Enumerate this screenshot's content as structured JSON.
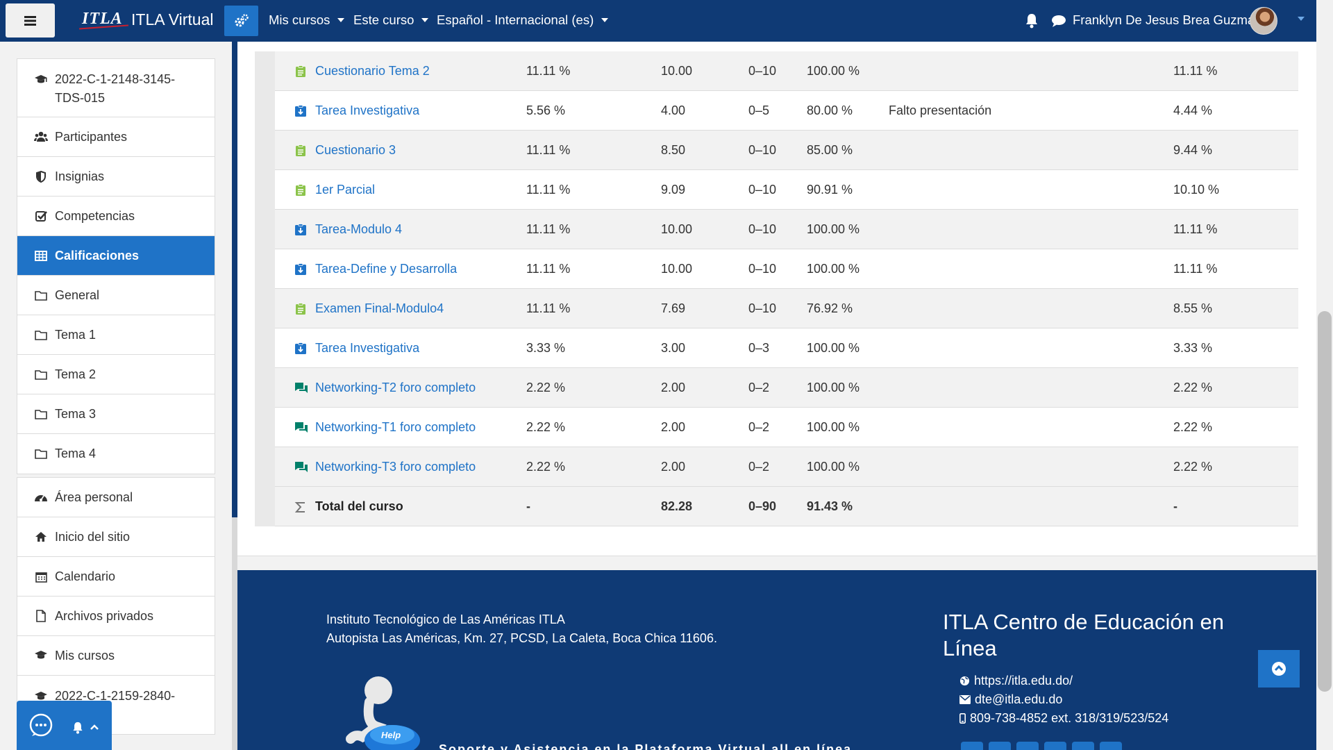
{
  "navbar": {
    "logo": "ITLA",
    "site_name": "ITLA Virtual",
    "menus": [
      "Mis cursos",
      "Este curso",
      "Español - Internacional (es)"
    ],
    "username": "Franklyn De Jesus Brea Guzman",
    "bg_color": "#0f3a75",
    "accent_color": "#1f73c7"
  },
  "drawer": {
    "course_group": [
      {
        "label": "2022-C-1-2148-3145-TDS-015",
        "icon": "graduation-cap-icon"
      },
      {
        "label": "Participantes",
        "icon": "users-icon"
      },
      {
        "label": "Insignias",
        "icon": "shield-icon"
      },
      {
        "label": "Competencias",
        "icon": "checkbox-icon"
      },
      {
        "label": "Calificaciones",
        "icon": "table-icon",
        "active": true
      },
      {
        "label": "General",
        "icon": "folder-icon"
      },
      {
        "label": "Tema 1",
        "icon": "folder-icon"
      },
      {
        "label": "Tema 2",
        "icon": "folder-icon"
      },
      {
        "label": "Tema 3",
        "icon": "folder-icon"
      },
      {
        "label": "Tema 4",
        "icon": "folder-icon"
      }
    ],
    "site_group": [
      {
        "label": "Área personal",
        "icon": "dashboard-icon"
      },
      {
        "label": "Inicio del sitio",
        "icon": "home-icon"
      },
      {
        "label": "Calendario",
        "icon": "calendar-icon"
      },
      {
        "label": "Archivos privados",
        "icon": "file-icon"
      },
      {
        "label": "Mis cursos",
        "icon": "graduation-cap-icon"
      },
      {
        "label": "2022-C-1-2159-2840-",
        "icon": "graduation-cap-icon"
      }
    ]
  },
  "grades": {
    "rows": [
      {
        "name": "Cuestionario Tema 2",
        "type": "quiz",
        "weight": "11.11 %",
        "grade": "10.00",
        "range": "0–10",
        "percentage": "100.00 %",
        "feedback": "",
        "contribution": "11.11 %"
      },
      {
        "name": "Tarea Investigativa",
        "type": "assign",
        "weight": "5.56 %",
        "grade": "4.00",
        "range": "0–5",
        "percentage": "80.00 %",
        "feedback": "Falto presentación",
        "contribution": "4.44 %"
      },
      {
        "name": "Cuestionario 3",
        "type": "quiz",
        "weight": "11.11 %",
        "grade": "8.50",
        "range": "0–10",
        "percentage": "85.00 %",
        "feedback": "",
        "contribution": "9.44 %"
      },
      {
        "name": "1er Parcial",
        "type": "quiz",
        "weight": "11.11 %",
        "grade": "9.09",
        "range": "0–10",
        "percentage": "90.91 %",
        "feedback": "",
        "contribution": "10.10 %"
      },
      {
        "name": "Tarea-Modulo 4",
        "type": "assign",
        "weight": "11.11 %",
        "grade": "10.00",
        "range": "0–10",
        "percentage": "100.00 %",
        "feedback": "",
        "contribution": "11.11 %"
      },
      {
        "name": "Tarea-Define y Desarrolla",
        "type": "assign",
        "weight": "11.11 %",
        "grade": "10.00",
        "range": "0–10",
        "percentage": "100.00 %",
        "feedback": "",
        "contribution": "11.11 %"
      },
      {
        "name": "Examen Final-Modulo4",
        "type": "quiz",
        "weight": "11.11 %",
        "grade": "7.69",
        "range": "0–10",
        "percentage": "76.92 %",
        "feedback": "",
        "contribution": "8.55 %"
      },
      {
        "name": "Tarea Investigativa",
        "type": "assign",
        "weight": "3.33 %",
        "grade": "3.00",
        "range": "0–3",
        "percentage": "100.00 %",
        "feedback": "",
        "contribution": "3.33 %"
      },
      {
        "name": "Networking-T2 foro completo",
        "type": "forum",
        "weight": "2.22 %",
        "grade": "2.00",
        "range": "0–2",
        "percentage": "100.00 %",
        "feedback": "",
        "contribution": "2.22 %"
      },
      {
        "name": "Networking-T1 foro completo",
        "type": "forum",
        "weight": "2.22 %",
        "grade": "2.00",
        "range": "0–2",
        "percentage": "100.00 %",
        "feedback": "",
        "contribution": "2.22 %"
      },
      {
        "name": "Networking-T3 foro completo",
        "type": "forum",
        "weight": "2.22 %",
        "grade": "2.00",
        "range": "0–2",
        "percentage": "100.00 %",
        "feedback": "",
        "contribution": "2.22 %"
      }
    ],
    "total": {
      "name": "Total del curso",
      "weight": "-",
      "grade": "82.28",
      "range": "0–90",
      "percentage": "91.43 %",
      "contribution": "-"
    }
  },
  "footer": {
    "address_line1": "Instituto Tecnológico de Las Américas ITLA",
    "address_line2": "Autopista Las Américas, Km. 27, PCSD, La Caleta, Boca Chica 11606.",
    "title": "ITLA Centro de Educación en Línea",
    "website": "https://itla.edu.do/",
    "email": "dte@itla.edu.do",
    "phone": "809-738-4852 ext. 318/319/523/524",
    "help_label": "Help",
    "slogan": "Soporte y Asistencia en la Plataforma Virtual all en línea"
  }
}
